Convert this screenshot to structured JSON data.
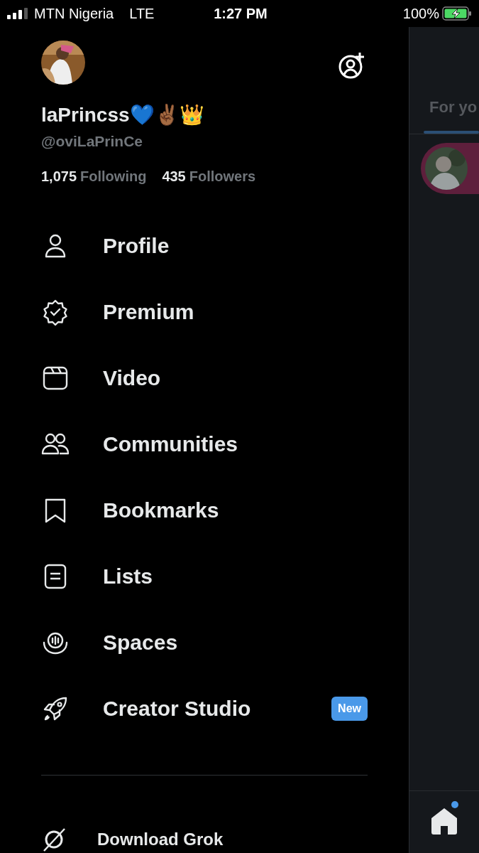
{
  "status_bar": {
    "carrier": "MTN Nigeria",
    "network": "LTE",
    "time": "1:27 PM",
    "battery": "100%"
  },
  "profile": {
    "name": "laPrincss💙✌🏾👑",
    "handle": "@oviLaPrinCe",
    "following_count": "1,075",
    "following_label": "Following",
    "followers_count": "435",
    "followers_label": "Followers"
  },
  "menu": [
    {
      "label": "Profile"
    },
    {
      "label": "Premium"
    },
    {
      "label": "Video"
    },
    {
      "label": "Communities"
    },
    {
      "label": "Bookmarks"
    },
    {
      "label": "Lists"
    },
    {
      "label": "Spaces"
    },
    {
      "label": "Creator Studio",
      "badge": "New"
    }
  ],
  "footer_item": {
    "label": "Download Grok"
  },
  "background_feed": {
    "tab": "For yo",
    "home_notification": true
  }
}
